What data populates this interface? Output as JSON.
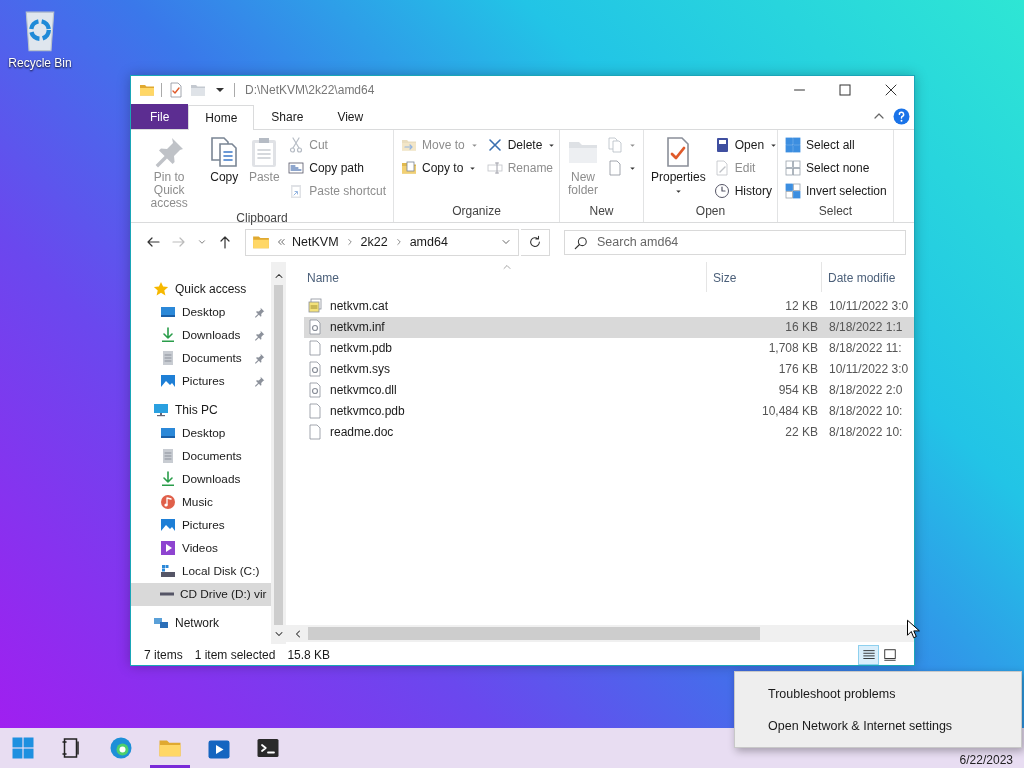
{
  "desktop_icons": [
    {
      "label": "Recycle Bin"
    }
  ],
  "window": {
    "title": "D:\\NetKVM\\2k22\\amd64"
  },
  "ribbon_tabs": [
    {
      "label": "File",
      "kind": "menu",
      "selected": false
    },
    {
      "label": "Home",
      "kind": "tab",
      "selected": true
    },
    {
      "label": "Share",
      "kind": "tab",
      "selected": false
    },
    {
      "label": "View",
      "kind": "tab",
      "selected": false
    }
  ],
  "ribbon_groups": [
    {
      "label": "Clipboard",
      "columns": [
        {
          "kind": "large",
          "label": "Pin to Quick access",
          "disabled": true,
          "dropdown": false
        },
        {
          "kind": "large",
          "label": "Copy",
          "disabled": false,
          "dropdown": false
        },
        {
          "kind": "large",
          "label": "Paste",
          "disabled": true,
          "dropdown": false
        },
        {
          "kind": "stack",
          "items": [
            {
              "label": "Cut",
              "disabled": true,
              "dropdown": false
            },
            {
              "label": "Copy path",
              "disabled": false,
              "dropdown": false
            },
            {
              "label": "Paste shortcut",
              "disabled": true,
              "dropdown": false
            }
          ]
        }
      ]
    },
    {
      "label": "Organize",
      "columns": [
        {
          "kind": "stack",
          "items": [
            {
              "label": "Move to",
              "disabled": true,
              "dropdown": true
            },
            {
              "label": "Copy to",
              "disabled": false,
              "dropdown": true
            }
          ]
        },
        {
          "kind": "stack",
          "items": [
            {
              "label": "Delete",
              "disabled": false,
              "dropdown": true
            },
            {
              "label": "Rename",
              "disabled": true,
              "dropdown": false
            }
          ]
        }
      ]
    },
    {
      "label": "New",
      "columns": [
        {
          "kind": "large",
          "label": "New folder",
          "disabled": true,
          "dropdown": false
        },
        {
          "kind": "stack",
          "items": [
            {
              "disabled": true,
              "dropdown": true
            },
            {
              "disabled": false,
              "dropdown": true
            }
          ]
        }
      ]
    },
    {
      "label": "Open",
      "columns": [
        {
          "kind": "large",
          "label": "Properties",
          "disabled": false,
          "dropdown": true
        },
        {
          "kind": "stack",
          "items": [
            {
              "label": "Open",
              "disabled": false,
              "dropdown": true
            },
            {
              "label": "Edit",
              "disabled": true,
              "dropdown": false
            },
            {
              "label": "History",
              "disabled": false,
              "dropdown": false
            }
          ]
        }
      ]
    },
    {
      "label": "Select",
      "columns": [
        {
          "kind": "stack",
          "items": [
            {
              "label": "Select all",
              "disabled": false,
              "dropdown": false
            },
            {
              "label": "Select none",
              "disabled": false,
              "dropdown": false
            },
            {
              "label": "Invert selection",
              "disabled": false,
              "dropdown": false
            }
          ]
        }
      ]
    }
  ],
  "address_bar": {
    "breadcrumbs": [
      "NetKVM",
      "2k22",
      "amd64"
    ],
    "search_placeholder": "Search amd64"
  },
  "navigation_pane": [
    {
      "label": "Quick access",
      "selected": false,
      "children": [
        {
          "label": "Desktop",
          "pinned": true,
          "selected": false
        },
        {
          "label": "Downloads",
          "pinned": true,
          "selected": false
        },
        {
          "label": "Documents",
          "pinned": true,
          "selected": false
        },
        {
          "label": "Pictures",
          "pinned": true,
          "selected": false
        }
      ]
    },
    {
      "label": "This PC",
      "selected": false,
      "children": [
        {
          "label": "Desktop",
          "pinned": false,
          "selected": false
        },
        {
          "label": "Documents",
          "pinned": false,
          "selected": false
        },
        {
          "label": "Downloads",
          "pinned": false,
          "selected": false
        },
        {
          "label": "Music",
          "pinned": false,
          "selected": false
        },
        {
          "label": "Pictures",
          "pinned": false,
          "selected": false
        },
        {
          "label": "Videos",
          "pinned": false,
          "selected": false
        },
        {
          "label": "Local Disk (C:)",
          "pinned": false,
          "selected": false
        },
        {
          "label": "CD Drive (D:) vir",
          "pinned": false,
          "selected": true
        }
      ]
    },
    {
      "label": "Network",
      "selected": false
    }
  ],
  "file_list": {
    "columns": [
      "Name",
      "Size",
      "Date modifie"
    ],
    "files": [
      {
        "name": "netkvm.cat",
        "size": "12 KB",
        "date": "10/11/2022 3:0",
        "selected": false
      },
      {
        "name": "netkvm.inf",
        "size": "16 KB",
        "date": "8/18/2022 1:1",
        "selected": true
      },
      {
        "name": "netkvm.pdb",
        "size": "1,708 KB",
        "date": "8/18/2022 11:",
        "selected": false
      },
      {
        "name": "netkvm.sys",
        "size": "176 KB",
        "date": "10/11/2022 3:0",
        "selected": false
      },
      {
        "name": "netkvmco.dll",
        "size": "954 KB",
        "date": "8/18/2022 2:0",
        "selected": false
      },
      {
        "name": "netkvmco.pdb",
        "size": "10,484 KB",
        "date": "8/18/2022 10:",
        "selected": false
      },
      {
        "name": "readme.doc",
        "size": "22 KB",
        "date": "8/18/2022 10:",
        "selected": false
      }
    ]
  },
  "status_bar": {
    "item_count": "7 items",
    "selection": "1 item selected",
    "selection_size": "15.8 KB"
  },
  "view_buttons": [
    {
      "selected": true
    },
    {
      "selected": false
    }
  ],
  "context_menu": {
    "items": [
      "Troubleshoot problems",
      "Open Network & Internet settings"
    ]
  },
  "taskbar": {
    "apps": [
      {
        "active": false
      },
      {
        "active": false
      },
      {
        "active": false
      },
      {
        "active": true
      },
      {
        "active": false
      },
      {
        "active": false
      }
    ],
    "date": "6/22/2023"
  }
}
